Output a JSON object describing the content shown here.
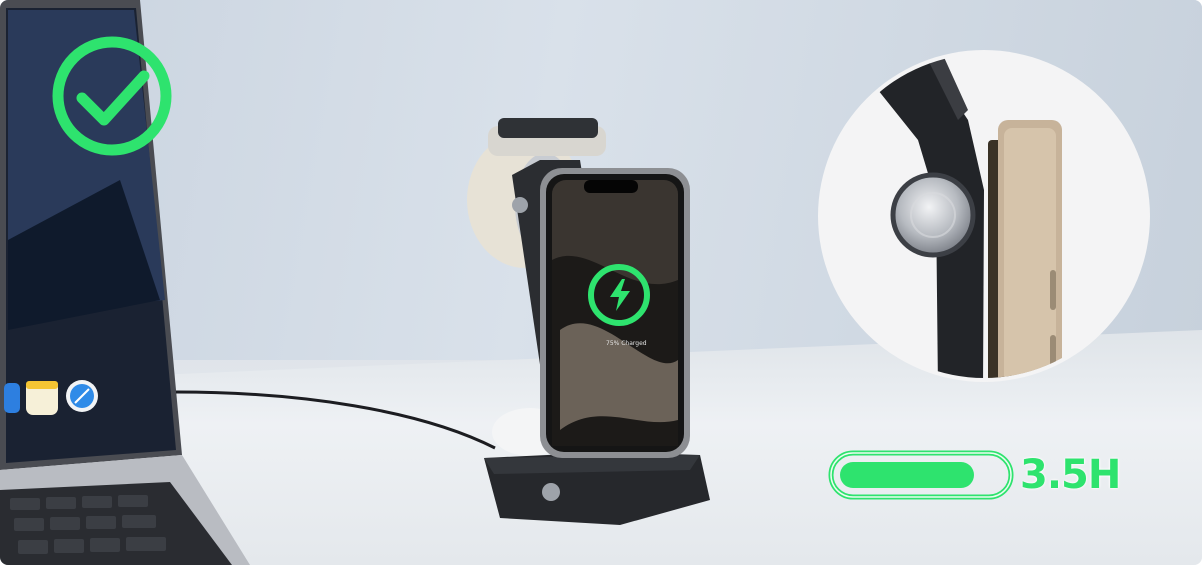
{
  "product": {
    "screen_status": "75% Charged",
    "battery_duration": "3.5H",
    "battery_level": 0.82
  },
  "colors": {
    "accent_green": "#2ee36e",
    "stand_black": "#2b2d31",
    "wall": "#d3dde8"
  },
  "icons": [
    "check-circle-icon",
    "battery-icon",
    "charging-bolt-icon"
  ]
}
